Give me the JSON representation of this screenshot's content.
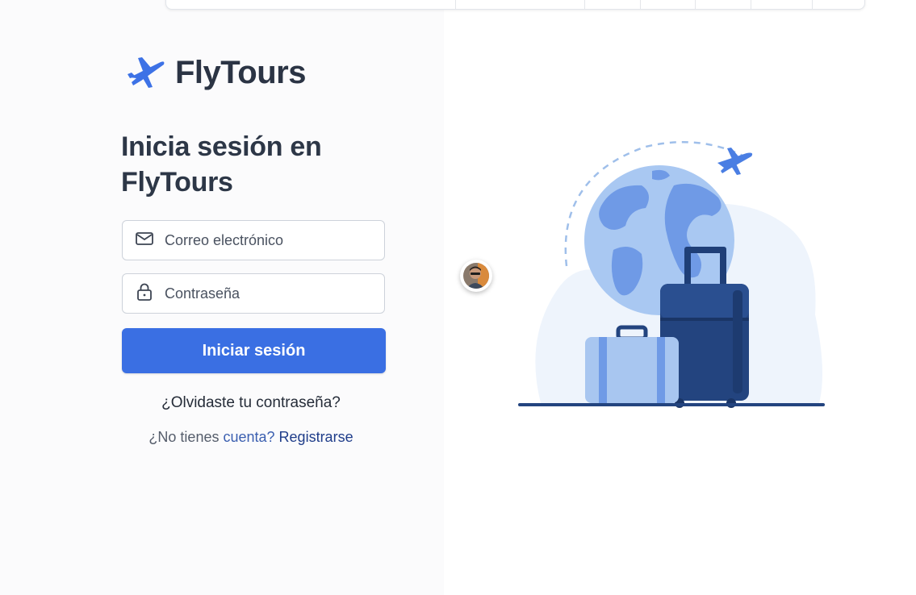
{
  "brand": {
    "name": "FlyTours"
  },
  "login": {
    "headline": "Inicia sesión en FlyTours",
    "email_placeholder": "Correo electrónico",
    "password_placeholder": "Contraseña",
    "submit_label": "Iniciar sesión",
    "forgot_link": "¿Olvidaste tu contraseña?",
    "signup_prompt": "¿No tienes ",
    "signup_prompt_accent": "cuenta?",
    "signup_link": "Registrarse"
  },
  "icons": {
    "logo": "airplane-icon",
    "email": "mail-icon",
    "password": "lock-icon",
    "illustration": "travel-globe-luggage-illustration"
  },
  "colors": {
    "primary": "#3a6fe3",
    "text_dark": "#2b3444",
    "link_dark": "#1f3d8a",
    "globe_light": "#a9c8f2",
    "globe_land": "#5b8ee6",
    "suitcase_dark": "#23447f",
    "suitcase_light": "#a8c6f0"
  }
}
